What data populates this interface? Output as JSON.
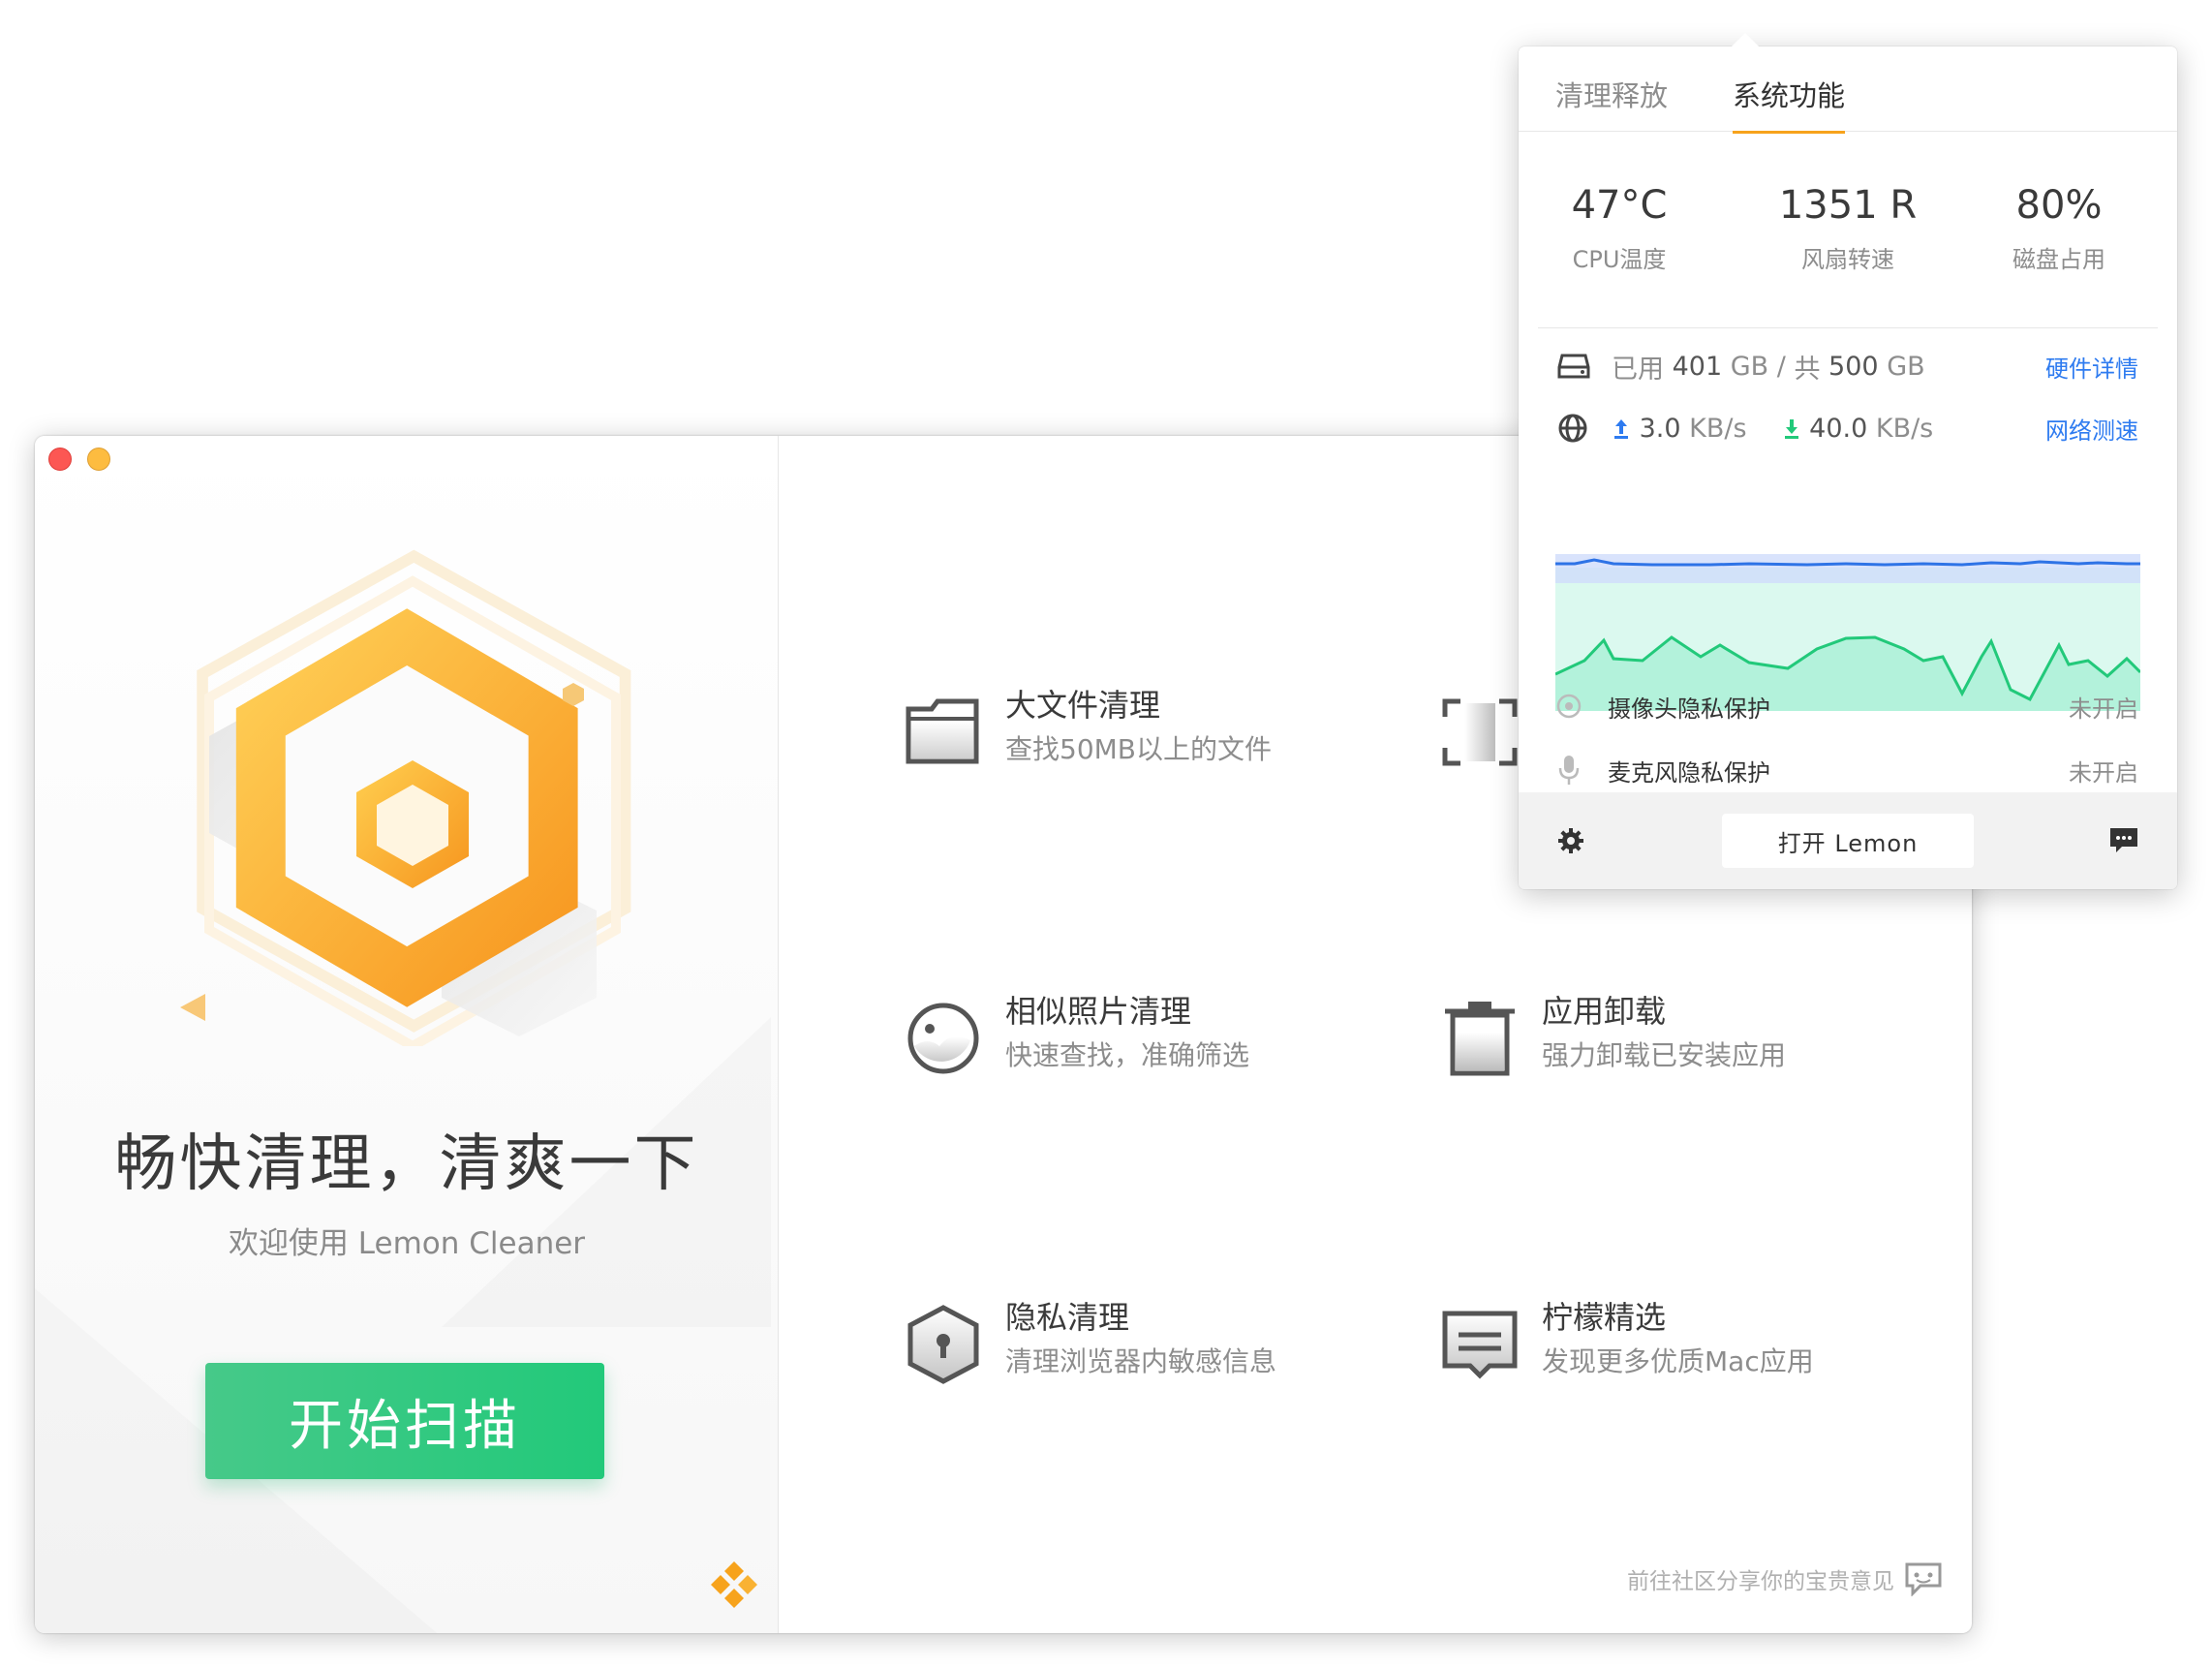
{
  "main": {
    "headline": "畅快清理，清爽一下",
    "subline": "欢迎使用 Lemon Cleaner",
    "scan_button": "开始扫描",
    "features": [
      {
        "icon": "folder-icon",
        "title": "大文件清理",
        "desc": "查找50MB以上的文件"
      },
      {
        "icon": "duplicate-icon",
        "title": "",
        "desc": ""
      },
      {
        "icon": "photo-icon",
        "title": "相似照片清理",
        "desc": "快速查找，准确筛选"
      },
      {
        "icon": "trash-icon",
        "title": "应用卸载",
        "desc": "强力卸载已安装应用"
      },
      {
        "icon": "keyhole-shield-icon",
        "title": "隐私清理",
        "desc": "清理浏览器内敏感信息"
      },
      {
        "icon": "store-icon",
        "title": "柠檬精选",
        "desc": "发现更多优质Mac应用"
      }
    ],
    "community_link": "前往社区分享你的宝贵意见"
  },
  "popover": {
    "tabs": [
      {
        "label": "清理释放"
      },
      {
        "label": "系统功能"
      }
    ],
    "active_tab": "系统功能",
    "stats": [
      {
        "value": "47°C",
        "label": "CPU温度"
      },
      {
        "value": "1351 R",
        "label": "风扇转速"
      },
      {
        "value": "80%",
        "label": "磁盘占用"
      }
    ],
    "disk": {
      "used": "已用",
      "used_value": "401",
      "unit1": "GB /",
      "total_label": "共",
      "total_value": "500",
      "unit2": "GB",
      "link": "硬件详情"
    },
    "network": {
      "up_value": "3.0",
      "up_unit": "KB/s",
      "down_value": "40.0",
      "down_unit": "KB/s",
      "link": "网络测速"
    },
    "privacy": [
      {
        "label": "摄像头隐私保护",
        "status": "未开启"
      },
      {
        "label": "麦克风隐私保护",
        "status": "未开启"
      }
    ],
    "open_button": "打开 Lemon",
    "colors": {
      "accent": "#f7a31c",
      "link": "#2e7bf0",
      "upload": "#2e7bf0",
      "download": "#22c97a",
      "scan_button": "#22c97a"
    }
  }
}
